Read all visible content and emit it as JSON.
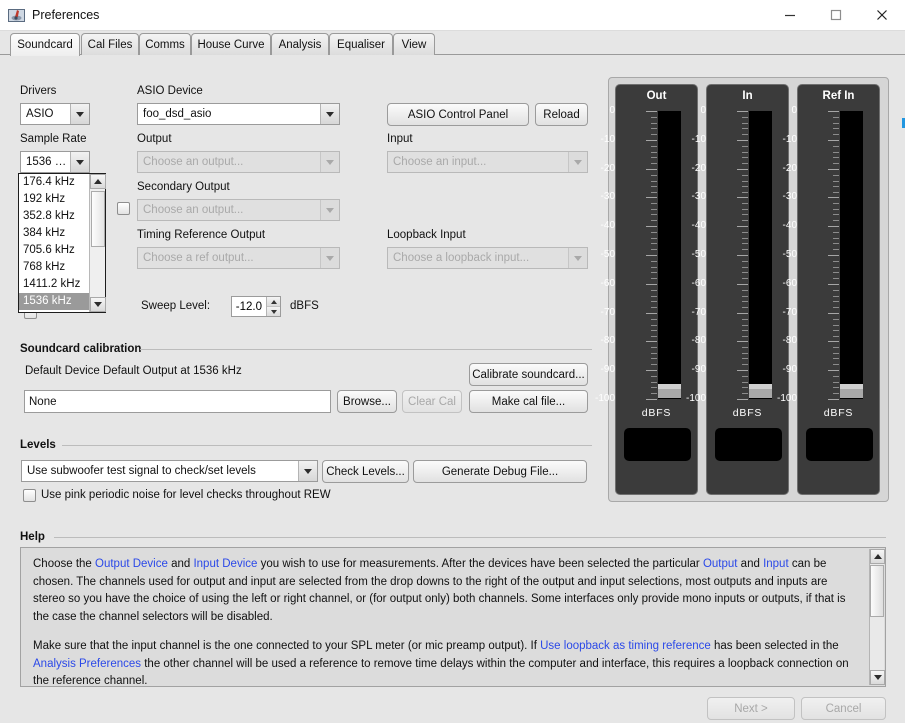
{
  "window": {
    "title": "Preferences",
    "minimize_label": "Minimize",
    "maximize_label": "Maximize",
    "close_label": "Close"
  },
  "tabs": [
    {
      "label": "Soundcard",
      "active": true
    },
    {
      "label": "Cal Files",
      "active": false
    },
    {
      "label": "Comms",
      "active": false
    },
    {
      "label": "House Curve",
      "active": false
    },
    {
      "label": "Analysis",
      "active": false
    },
    {
      "label": "Equaliser",
      "active": false
    },
    {
      "label": "View",
      "active": false
    }
  ],
  "soundcard": {
    "drivers_label": "Drivers",
    "drivers_value": "ASIO",
    "sample_rate_label": "Sample Rate",
    "sample_rate_value": "1536 kHz",
    "sample_rate_options": [
      "176.4 kHz",
      "192 kHz",
      "352.8 kHz",
      "384 kHz",
      "705.6 kHz",
      "768 kHz",
      "1411.2 kHz",
      "1536 kHz"
    ],
    "sample_rate_selected": "1536 kHz",
    "asio_device_label": "ASIO Device",
    "asio_device_value": "foo_dsd_asio",
    "output_label": "Output",
    "output_value": "Choose an output...",
    "secondary_output_label": "Secondary Output",
    "secondary_output_value": "Choose an output...",
    "timing_reference_output_label": "Timing Reference Output",
    "timing_reference_output_value": "Choose a ref output...",
    "input_label": "Input",
    "input_value": "Choose an input...",
    "loopback_input_label": "Loopback Input",
    "loopback_input_value": "Choose a loopback input...",
    "asio_control_panel_button": "ASIO Control Panel",
    "reload_button": "Reload",
    "sweep_level_label": "Sweep Level:",
    "sweep_level_value": "-12.0",
    "sweep_level_units": "dBFS"
  },
  "calibration": {
    "section_title": "Soundcard calibration",
    "device_text": "Default Device Default Output at 1536 kHz",
    "cal_file_value": "None",
    "browse_button": "Browse...",
    "clear_cal_button": "Clear Cal",
    "calibrate_button": "Calibrate soundcard...",
    "make_cal_file_button": "Make cal file..."
  },
  "levels": {
    "section_title": "Levels",
    "test_signal_value": "Use subwoofer test signal to check/set levels",
    "check_levels_button": "Check Levels...",
    "generate_debug_button": "Generate Debug File...",
    "pink_noise_checkbox_label": "Use pink periodic noise for level checks throughout REW"
  },
  "meters": {
    "panels": [
      {
        "title": "Out",
        "units": "dBFS"
      },
      {
        "title": "In",
        "units": "dBFS"
      },
      {
        "title": "Ref In",
        "units": "dBFS"
      }
    ],
    "scale_labels": [
      "0",
      "-10",
      "-20",
      "-30",
      "-40",
      "-50",
      "-60",
      "-70",
      "-80",
      "-90",
      "-100"
    ],
    "scale_min": -100,
    "scale_max": 0
  },
  "help": {
    "section_title": "Help",
    "paragraph1": [
      {
        "t": "Choose the ",
        "link": false
      },
      {
        "t": "Output Device",
        "link": true
      },
      {
        "t": " and ",
        "link": false
      },
      {
        "t": "Input Device",
        "link": true
      },
      {
        "t": " you wish to use for measurements. After the devices have been selected the particular ",
        "link": false
      },
      {
        "t": "Output",
        "link": true
      },
      {
        "t": " and ",
        "link": false
      },
      {
        "t": "Input",
        "link": true
      },
      {
        "t": " can be chosen. The channels used for output and input are selected from the drop downs to the right of the output and input selections, most outputs and inputs are stereo so you have the choice of using the left or right channel, or (for output only) both channels. Some interfaces only provide mono inputs or outputs, if that is the case the channel selectors will be disabled.",
        "link": false
      }
    ],
    "paragraph2": [
      {
        "t": "Make sure that the input channel is the one connected to your SPL meter (or mic preamp output). If ",
        "link": false
      },
      {
        "t": "Use loopback as timing reference",
        "link": true
      },
      {
        "t": " has been selected in the ",
        "link": false
      },
      {
        "t": "Analysis Preferences",
        "link": true
      },
      {
        "t": " the other channel will be used a reference to remove time delays within the computer and interface, this requires a loopback connection on the reference channel.",
        "link": false
      }
    ]
  },
  "footer": {
    "next_button": "Next >",
    "cancel_button": "Cancel"
  },
  "colors": {
    "link": "#2b49e8",
    "dialog_bg": "#e6e6e6",
    "meter_panel_bg": "#d6d6d6",
    "meter_bg": "#3b3b3b",
    "meter_bar": "#000000"
  }
}
